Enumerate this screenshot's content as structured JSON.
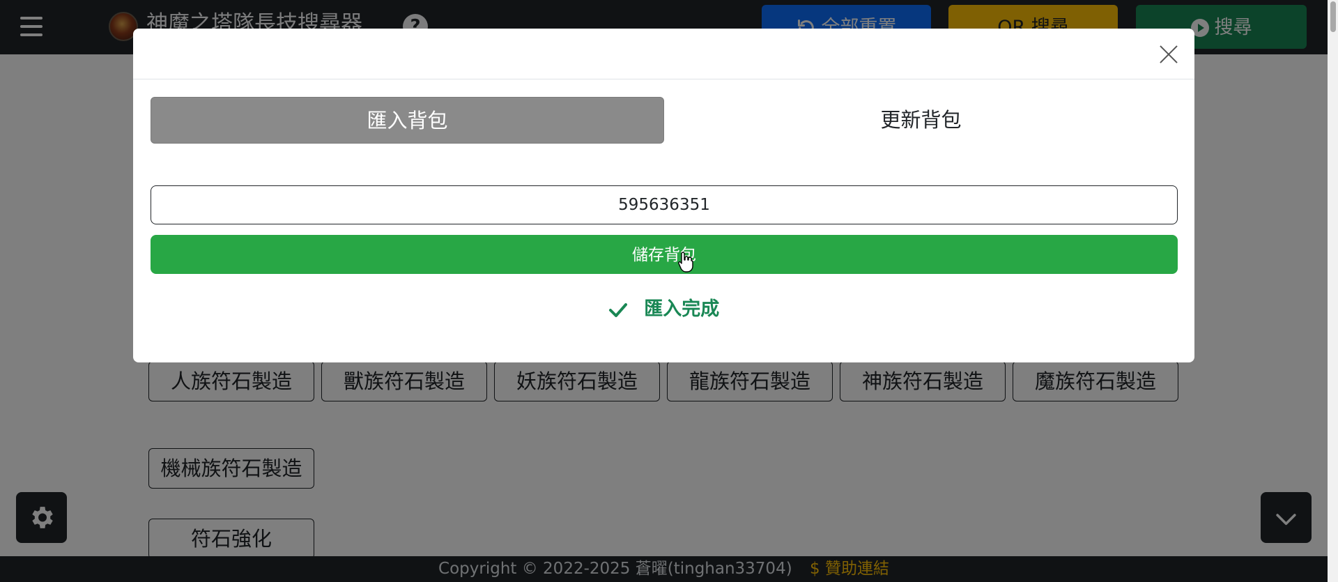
{
  "navbar": {
    "title": "神魔之塔隊長技搜尋器",
    "help_icon": "?",
    "reset_label": "全部重置",
    "qr_label": "QR 搜尋",
    "search_label": "搜尋"
  },
  "page": {
    "buttons_row1": [
      "人族符石製造",
      "獸族符石製造",
      "妖族符石製造",
      "龍族符石製造",
      "神族符石製造",
      "魔族符石製造"
    ],
    "buttons_row2": [
      "機械族符石製造"
    ],
    "buttons_row3": [
      "符石強化"
    ]
  },
  "modal": {
    "tabs": [
      {
        "label": "匯入背包",
        "active": true
      },
      {
        "label": "更新背包",
        "active": false
      }
    ],
    "input_value": "595636351",
    "save_label": "儲存背包",
    "status_text": "匯入完成"
  },
  "footer": {
    "copyright": "Copyright © 2022-2025 蒼曜(tinghan33704)",
    "sponsor_symbol": "$",
    "sponsor_label": "贊助連結"
  },
  "colors": {
    "navbar": "#212529",
    "primary": "#0d6efd",
    "warning": "#ffc107",
    "success": "#198754",
    "save_button": "#28a745",
    "backdrop": "rgba(0,0,0,0.5)"
  },
  "icons": [
    "hamburger-icon",
    "logo-icon",
    "help-icon",
    "undo-icon",
    "play-icon",
    "close-icon",
    "check-icon",
    "gear-icon",
    "chevron-down-icon",
    "dollar-icon"
  ]
}
